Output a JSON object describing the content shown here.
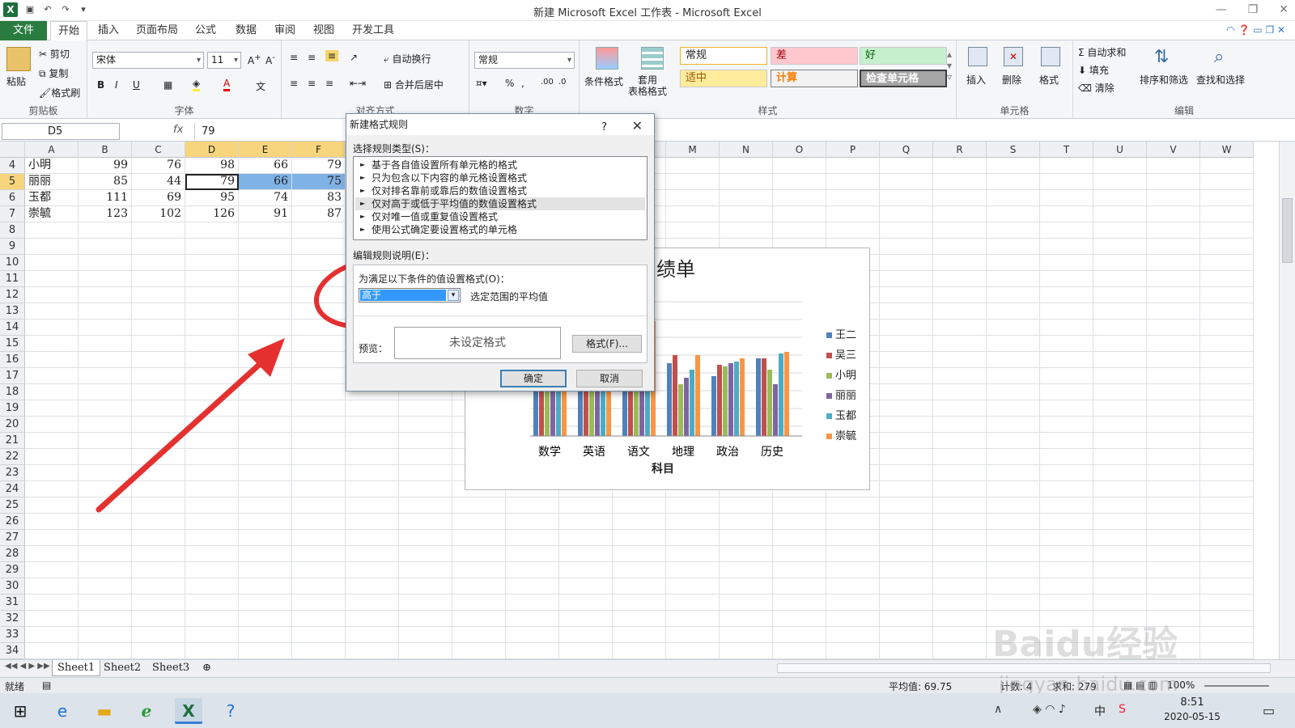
{
  "window": {
    "title": "新建 Microsoft Excel 工作表 - Microsoft Excel"
  },
  "ribbon_tabs": [
    "文件",
    "开始",
    "插入",
    "页面布局",
    "公式",
    "数据",
    "审阅",
    "视图",
    "开发工具"
  ],
  "clipboard": {
    "paste": "粘贴",
    "cut": "剪切",
    "copy": "复制",
    "format_painter": "格式刷",
    "label": "剪贴板"
  },
  "font": {
    "name": "宋体",
    "size": "11",
    "label": "字体"
  },
  "alignment": {
    "wrap": "自动换行",
    "merge": "合并后居中",
    "label": "对齐方式"
  },
  "number": {
    "format": "常规",
    "label": "数字"
  },
  "styles": {
    "conditional": "条件格式",
    "table": "套用\n表格格式",
    "cells": [
      "常规",
      "差",
      "好",
      "适中",
      "计算",
      "检查单元格"
    ],
    "label": "样式"
  },
  "cells_group": {
    "insert": "插入",
    "delete": "删除",
    "format": "格式",
    "label": "单元格"
  },
  "editing": {
    "autosum": "自动求和",
    "fill": "填充",
    "clear": "清除",
    "sort": "排序和筛选",
    "find": "查找和选择",
    "label": "编辑"
  },
  "formula_bar": {
    "name_box": "D5",
    "fx": "fx",
    "value": "79"
  },
  "columns": [
    "A",
    "B",
    "C",
    "D",
    "E",
    "F",
    "G",
    "H",
    "I",
    "J",
    "K",
    "L",
    "M",
    "N",
    "O",
    "P",
    "Q",
    "R",
    "S",
    "T",
    "U",
    "V",
    "W"
  ],
  "rows": [
    {
      "num": "4",
      "cells": [
        "小明",
        "99",
        "76",
        "98",
        "66",
        "79"
      ]
    },
    {
      "num": "5",
      "cells": [
        "丽丽",
        "85",
        "44",
        "79",
        "66",
        "75"
      ]
    },
    {
      "num": "6",
      "cells": [
        "玉都",
        "111",
        "69",
        "95",
        "74",
        "83"
      ]
    },
    {
      "num": "7",
      "cells": [
        "崇毓",
        "123",
        "102",
        "126",
        "91",
        "87"
      ]
    }
  ],
  "empty_rows": [
    "8",
    "9",
    "10",
    "11",
    "12",
    "13",
    "14",
    "15",
    "16",
    "17",
    "18",
    "19",
    "20",
    "21",
    "22",
    "23",
    "24",
    "25",
    "26",
    "27",
    "28",
    "29",
    "30",
    "31",
    "32",
    "33",
    "34"
  ],
  "chart": {
    "title_visible": "绩单",
    "categories": [
      "数学",
      "英语",
      "语文",
      "地理",
      "政治",
      "历史"
    ],
    "xlabel": "科目",
    "legend": [
      "王二",
      "吴三",
      "小明",
      "丽丽",
      "玉都",
      "崇毓"
    ],
    "colors": [
      "#4f81bd",
      "#c0504d",
      "#9bbb59",
      "#8064a2",
      "#4bacc6",
      "#f79646"
    ]
  },
  "dialog": {
    "title": "新建格式规则",
    "help": "?",
    "close": "✕",
    "select_type_label": "选择规则类型(S)：",
    "rule_types": [
      "基于各自值设置所有单元格的格式",
      "只为包含以下内容的单元格设置格式",
      "仅对排名靠前或靠后的数值设置格式",
      "仅对高于或低于平均值的数值设置格式",
      "仅对唯一值或重复值设置格式",
      "使用公式确定要设置格式的单元格"
    ],
    "edit_desc_label": "编辑规则说明(E)：",
    "condition_label": "为满足以下条件的值设置格式(O)：",
    "condition_value": "高于",
    "condition_suffix": "选定范围的平均值",
    "preview_label": "预览：",
    "preview_text": "未设定格式",
    "format_button": "格式(F)...",
    "ok": "确定",
    "cancel": "取消"
  },
  "sheets": [
    "Sheet1",
    "Sheet2",
    "Sheet3"
  ],
  "status": {
    "ready": "就绪",
    "average": "平均值: 69.75",
    "count": "计数: 4",
    "sum": "求和: 279",
    "zoom": "100%"
  },
  "taskbar": {
    "time": "8:51",
    "date": "2020-05-15",
    "ime": "中"
  },
  "watermark": {
    "text": "Baidu经验",
    "url": "jingyan.baidu.com"
  }
}
